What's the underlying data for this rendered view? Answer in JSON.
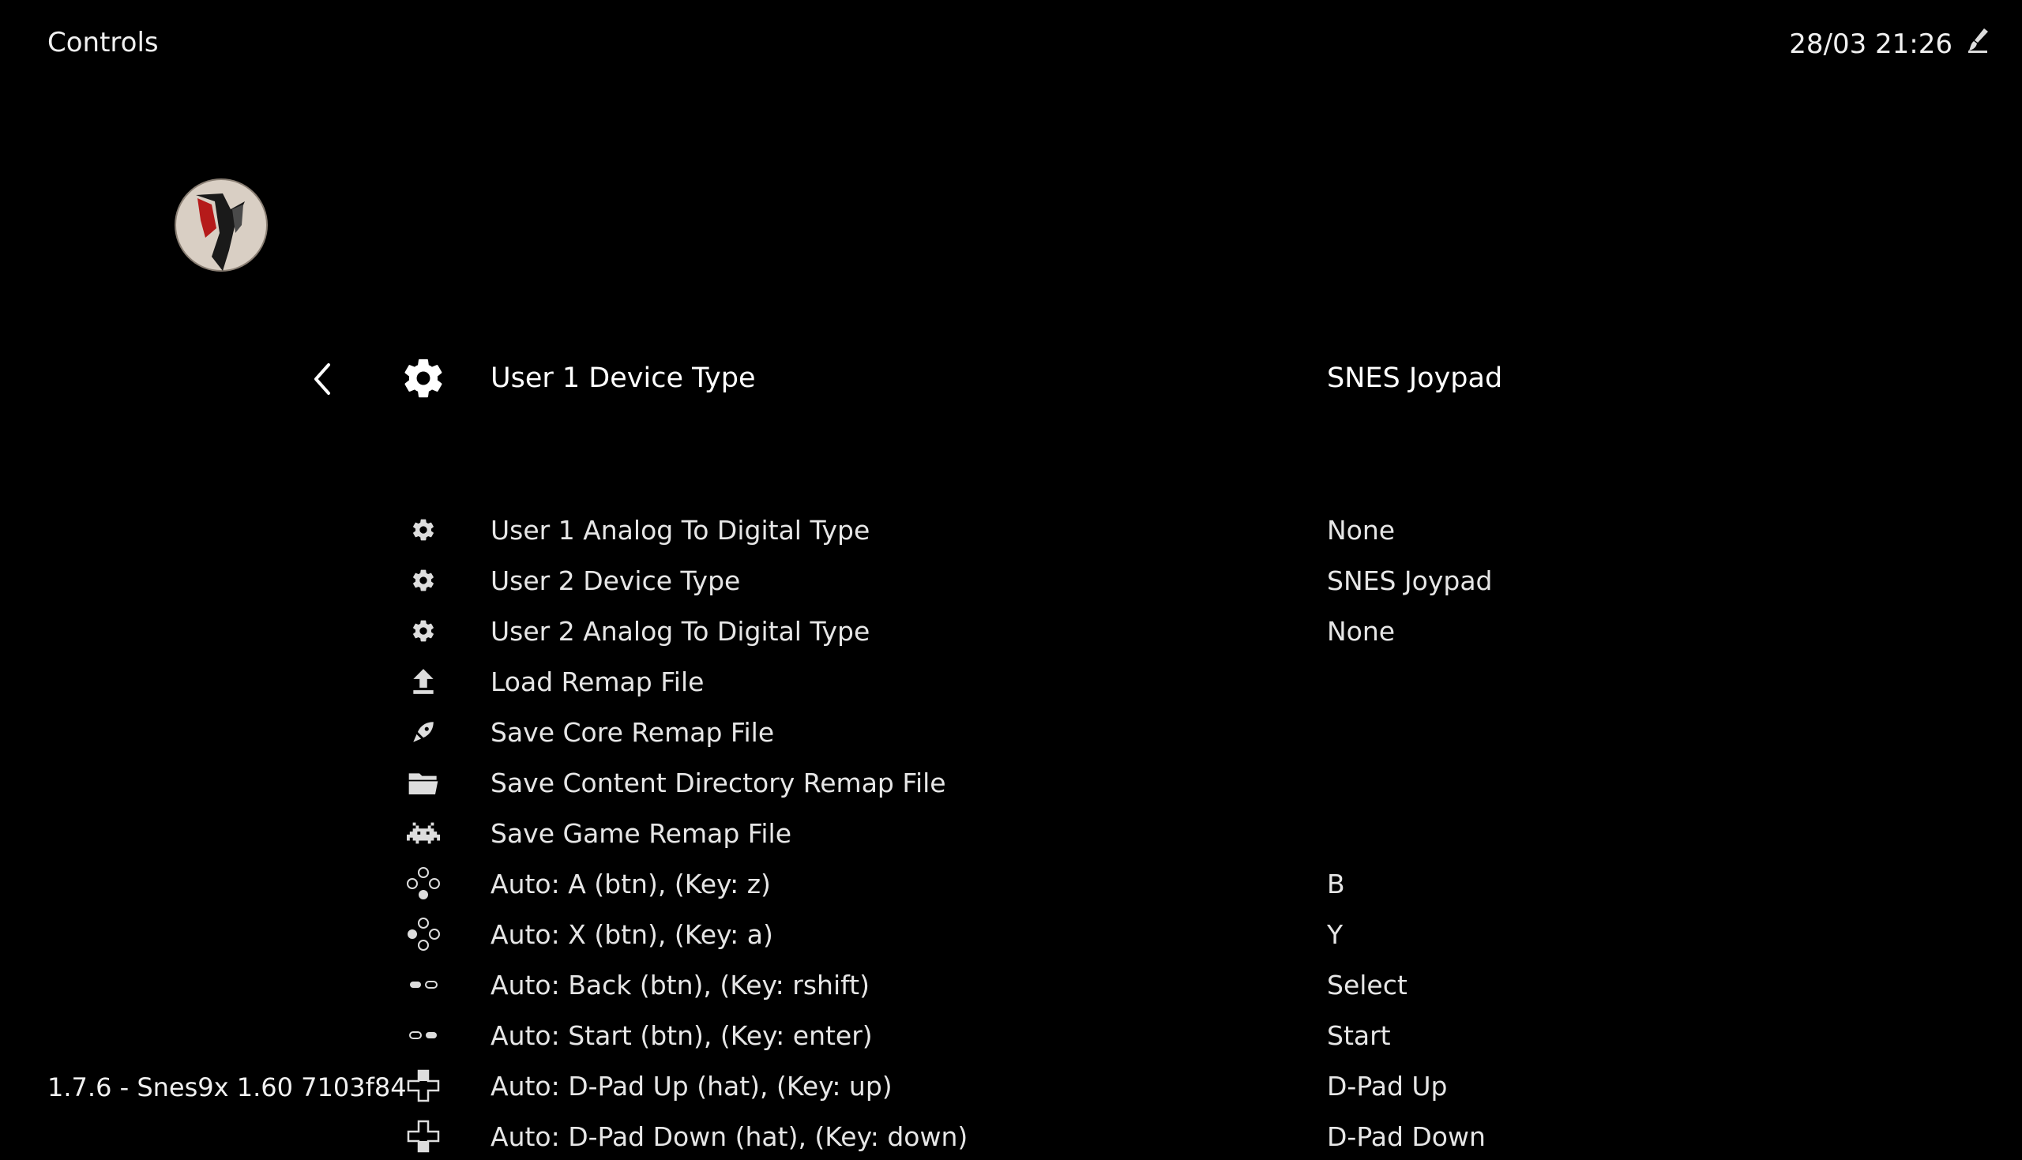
{
  "header": {
    "title": "Controls",
    "datetime": "28/03 21:26"
  },
  "footer": {
    "version": "1.7.6 - Snes9x 1.60 7103f84"
  },
  "menu": {
    "selected": {
      "label": "User 1 Device Type",
      "value": "SNES Joypad",
      "icon": "gear-icon"
    },
    "items": [
      {
        "label": "User 1 Analog To Digital Type",
        "value": "None",
        "icon": "gear-icon"
      },
      {
        "label": "User 2 Device Type",
        "value": "SNES Joypad",
        "icon": "gear-icon"
      },
      {
        "label": "User 2 Analog To Digital Type",
        "value": "None",
        "icon": "gear-icon"
      },
      {
        "label": "Load Remap File",
        "value": "",
        "icon": "upload-icon"
      },
      {
        "label": "Save Core Remap File",
        "value": "",
        "icon": "rocket-icon"
      },
      {
        "label": "Save Content Directory Remap File",
        "value": "",
        "icon": "folder-icon"
      },
      {
        "label": "Save Game Remap File",
        "value": "",
        "icon": "space-invader-icon"
      },
      {
        "label": "Auto: A (btn), (Key: z)",
        "value": "B",
        "icon": "face-buttons-bottom-icon"
      },
      {
        "label": "Auto: X (btn), (Key: a)",
        "value": "Y",
        "icon": "face-buttons-left-icon"
      },
      {
        "label": "Auto: Back (btn), (Key: rshift)",
        "value": "Select",
        "icon": "select-button-icon"
      },
      {
        "label": "Auto: Start (btn), (Key: enter)",
        "value": "Start",
        "icon": "start-button-icon"
      },
      {
        "label": "Auto:  D-Pad Up (hat), (Key: up)",
        "value": "D-Pad Up",
        "icon": "dpad-up-icon"
      },
      {
        "label": "Auto:  D-Pad Down (hat), (Key: down)",
        "value": "D-Pad Down",
        "icon": "dpad-down-icon"
      }
    ]
  }
}
